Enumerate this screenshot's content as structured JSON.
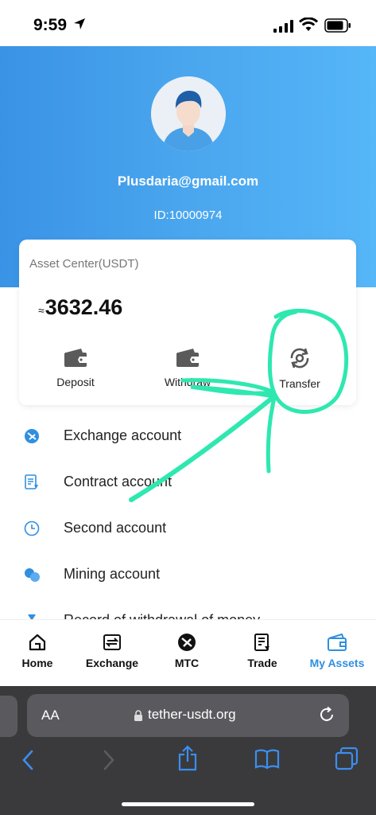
{
  "status_bar": {
    "time": "9:59"
  },
  "profile": {
    "email": "Plusdaria@gmail.com",
    "id": "ID:10000974"
  },
  "asset_card": {
    "title": "Asset Center(USDT)",
    "approx_symbol": "≈",
    "balance": "3632.46",
    "actions": [
      {
        "label": "Deposit",
        "icon": "wallet-icon"
      },
      {
        "label": "Withdraw",
        "icon": "wallet-icon"
      },
      {
        "label": "Transfer",
        "icon": "transfer-icon"
      }
    ]
  },
  "menu": {
    "items": [
      {
        "label": "Exchange account",
        "icon": "exchange-account-icon"
      },
      {
        "label": "Contract account",
        "icon": "contract-account-icon"
      },
      {
        "label": "Second account",
        "icon": "clock-icon"
      },
      {
        "label": "Mining account",
        "icon": "mining-icon"
      },
      {
        "label": "Record of withdrawal of money",
        "icon": "hourglass-icon"
      }
    ]
  },
  "tab_bar": {
    "tabs": [
      {
        "label": "Home",
        "icon": "home-icon"
      },
      {
        "label": "Exchange",
        "icon": "exchange-icon"
      },
      {
        "label": "MTC",
        "icon": "mtc-icon"
      },
      {
        "label": "Trade",
        "icon": "trade-icon"
      },
      {
        "label": "My Assets",
        "icon": "wallet-icon",
        "active": true
      }
    ]
  },
  "browser": {
    "text_size_label": "AA",
    "url": "tether-usdt.org"
  },
  "colors": {
    "header_start": "#3a93e6",
    "header_end": "#55b6f8",
    "accent": "#2f8fe0",
    "annotation": "#2ee8b0",
    "browser_chrome": "#3a3a3c"
  }
}
